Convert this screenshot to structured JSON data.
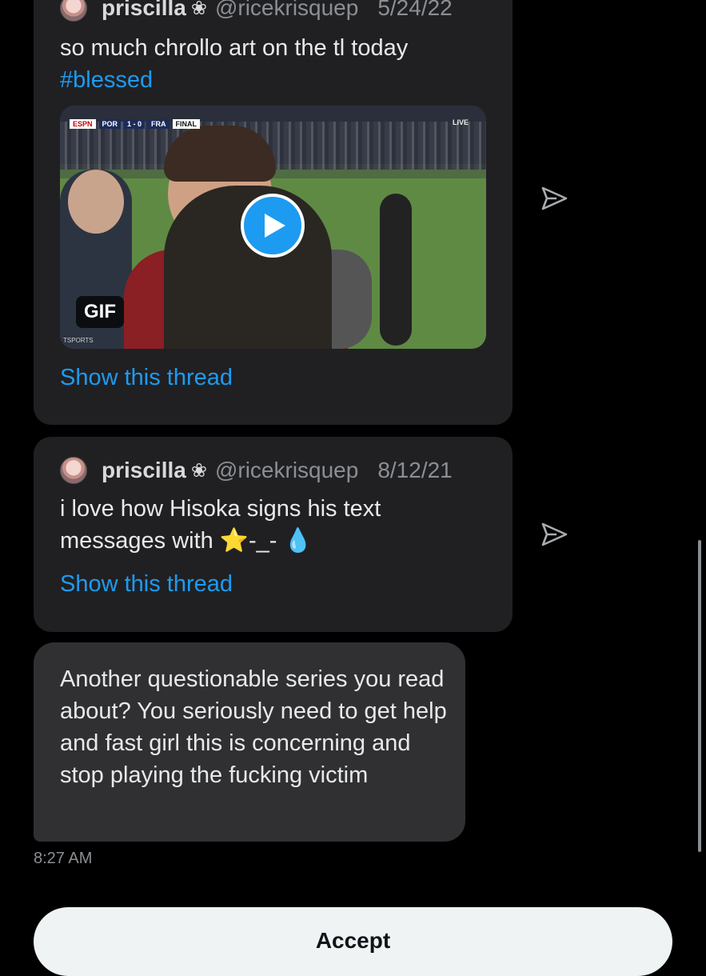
{
  "tweets": [
    {
      "name": "priscilla",
      "flower": "❀",
      "handle": "@ricekrisquep",
      "date": "5/24/22",
      "text": "so much chrollo art on the tl today",
      "hashtag": "#blessed",
      "media": {
        "type": "gif",
        "badge": "GIF",
        "scoreboard": [
          "ESPN",
          "POR",
          "1 - 0",
          "FRA",
          "FINAL"
        ],
        "live_label": "LIVE",
        "watermark": "TSPORTS"
      },
      "show_thread": "Show this thread"
    },
    {
      "name": "priscilla",
      "flower": "❀",
      "handle": "@ricekrisquep",
      "date": "8/12/21",
      "text_line1": "i love how Hisoka signs his text",
      "text_line2": "messages with  ⭐-_- 💧",
      "show_thread": "Show this thread"
    }
  ],
  "message": {
    "text": "Another questionable series you read about? You seriously need to get help and fast girl this is concerning and stop playing the fucking victim",
    "time": "8:27 AM"
  },
  "accept_button": "Accept",
  "icons": {
    "share": "send-icon",
    "play": "play-icon"
  },
  "colors": {
    "link": "#1d9bf0",
    "card": "#202023",
    "bubble": "#303033"
  }
}
